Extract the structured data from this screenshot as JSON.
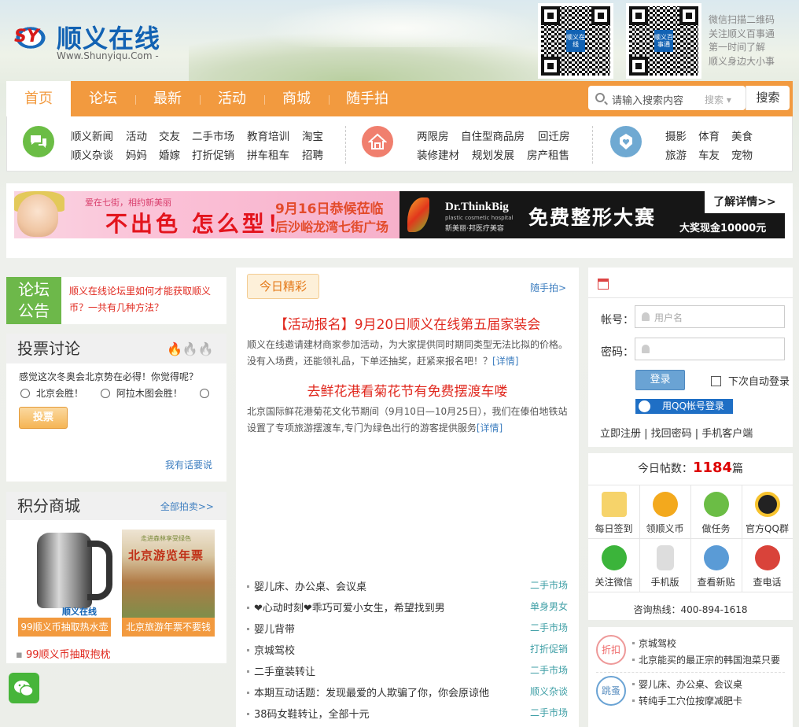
{
  "site": {
    "logo_badge": "SY",
    "logo_name": "顺义在线",
    "logo_url": "Www.Shunyiqu.Com -",
    "qr1_label": "顺义在线",
    "qr2_label": "顺义百事通",
    "wechat_lines": [
      "微信扫描二维码",
      "关注顺义百事通",
      "第一时间了解",
      "顺义身边大小事"
    ]
  },
  "nav": {
    "items": [
      "首页",
      "论坛",
      "最新",
      "活动",
      "商城",
      "随手拍"
    ],
    "search_placeholder": "请输入搜索内容",
    "search_scope": "搜索",
    "search_button": "搜索"
  },
  "categories": {
    "group1": [
      [
        "顺义新闻",
        "活动",
        "交友",
        "二手市场",
        "教育培训",
        "淘宝"
      ],
      [
        "顺义杂谈",
        "妈妈",
        "婚嫁",
        "打折促销",
        "拼车租车",
        "招聘"
      ]
    ],
    "group2": [
      [
        "两限房",
        "自住型商品房",
        "回迁房"
      ],
      [
        "装修建材",
        "规划发展",
        "房产租售"
      ]
    ],
    "group3": [
      [
        "摄影",
        "体育",
        "美食"
      ],
      [
        "旅游",
        "车友",
        "宠物"
      ]
    ]
  },
  "banner": {
    "left_small": "爱在七街，相约新美丽",
    "left_main": "不出色 怎么型！",
    "left_date": "9月16日恭候莅临",
    "left_place": "后沙峪龙湾七街广场",
    "right_brand": "Dr.ThinkBig",
    "right_brand_sub": "plastic cosmetic hospital",
    "right_brand_cn": "新美丽·邦医疗美容",
    "right_main": "免费整形大赛",
    "right_more": "了解详情>>",
    "right_prize": "大奖现金10000元"
  },
  "forum_notice": {
    "tag_line1": "论坛",
    "tag_line2": "公告",
    "text": "顺义在线论坛里如何才能获取顺义币？一共有几种方法？"
  },
  "vote": {
    "title": "投票讨论",
    "question": "感觉这次冬奥会北京势在必得！你觉得呢？",
    "options": [
      "北京会胜！",
      "阿拉木图会胜！"
    ],
    "button": "投票",
    "comment_link": "我有话要说"
  },
  "mall": {
    "title": "积分商城",
    "all_link": "全部拍卖>>",
    "products": [
      "99顺义币抽取热水壶",
      "北京旅游年票不要钱"
    ],
    "kettle_brand": "顺义在线",
    "travel_poster": "北京游览年票",
    "travel_small": "走进森林享受绿色",
    "extra": "99顺义币抽取抱枕"
  },
  "featured": {
    "tag": "今日精彩",
    "more": "随手拍>",
    "items": [
      {
        "headline": "【活动报名】9月20日顺义在线第五届家装会",
        "body": "顺义在线邀请建材商家参加活动，为大家提供同时期同类型无法比拟的价格。没有入场费，还能领礼品，下单还抽奖，赶紧来报名吧！？",
        "detail": "[详情]"
      },
      {
        "headline": "去鲜花港看菊花节有免费摆渡车喽",
        "body": "北京国际鲜花港菊花文化节期间（9月10日—10月25日），我们在傣伯地铁站设置了专项旅游摆渡车,专门为绿色出行的游客提供服务",
        "detail": "[详情]"
      }
    ],
    "list": [
      {
        "title": "婴儿床、办公桌、会议桌",
        "cat": "二手市场"
      },
      {
        "title": "❤心动时刻❤乖巧可爱小女生，希望找到男",
        "cat": "单身男女"
      },
      {
        "title": "婴儿背带",
        "cat": "二手市场"
      },
      {
        "title": "京城驾校",
        "cat": "打折促销"
      },
      {
        "title": "二手童装转让",
        "cat": "二手市场"
      },
      {
        "title": "本期互动话题：发现最爱的人欺骗了你，你会原谅他",
        "cat": "顺义杂谈"
      },
      {
        "title": "38码女鞋转让，全部十元",
        "cat": "二手市场"
      }
    ]
  },
  "login": {
    "account_label": "帐号：",
    "account_placeholder": "用户名",
    "password_label": "密码：",
    "login_button": "登录",
    "remember": "下次自动登录",
    "qq_login": "用QQ帐号登录",
    "links": "立即注册 | 找回密码 | 手机客户端"
  },
  "stats": {
    "prefix": "今日帖数：",
    "count": "1184",
    "suffix": "篇",
    "cells": [
      "每日签到",
      "领顺义币",
      "做任务",
      "官方QQ群",
      "关注微信",
      "手机版",
      "查看新贴",
      "查电话"
    ],
    "hotline": "咨询热线：400-894-1618"
  },
  "side_news": {
    "badge1": "折扣",
    "badge2": "跳蚤",
    "group1": [
      "京城驾校",
      "北京能买的最正宗的韩国泡菜只要"
    ],
    "group2": [
      "婴儿床、办公桌、会议桌",
      "转纯手工穴位按摩减肥卡"
    ]
  },
  "colors": {
    "accent": "#f29a3f",
    "headline_red": "#e0281e",
    "link_blue": "#3f7fc0",
    "green": "#6db84a"
  }
}
